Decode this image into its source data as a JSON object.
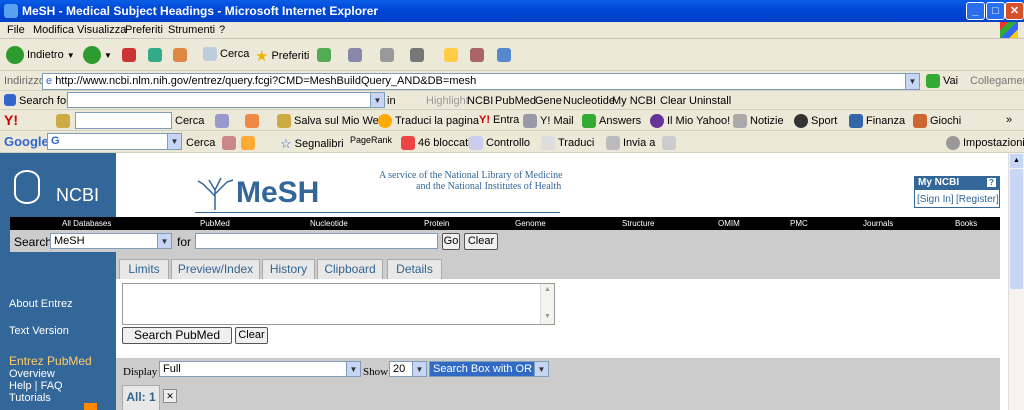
{
  "window": {
    "title": "MeSH - Medical Subject Headings - Microsoft Internet Explorer"
  },
  "menu": [
    "File",
    "Modifica",
    "Visualizza",
    "Preferiti",
    "Strumenti",
    "?"
  ],
  "toolbar": {
    "back": "Indietro",
    "search": "Cerca",
    "favorites": "Preferiti"
  },
  "address": {
    "label": "Indirizzo",
    "url": "http://www.ncbi.nlm.nih.gov/entrez/query.fcgi?CMD=MeshBuildQuery_AND&DB=mesh",
    "go": "Vai",
    "links": "Collegamenti"
  },
  "ncbi_bar": {
    "search_for": "Search for",
    "in": "in",
    "items": [
      "Highlight",
      "NCBI",
      "PubMed",
      "Gene",
      "Nucleotide",
      "My NCBI",
      "Clear",
      "Uninstall"
    ]
  },
  "yahoo_bar": {
    "cerca": "Cerca",
    "items": [
      "Salva sul Mio Web",
      "Traduci la pagina",
      "Entra",
      "Y! Mail",
      "Answers",
      "Il Mio Yahoo!",
      "Notizie",
      "Sport",
      "Finanza",
      "Giochi"
    ]
  },
  "google_bar": {
    "cerca": "Cerca",
    "items": [
      "Segnalibri",
      "PageRank",
      "46 bloccati",
      "Controllo",
      "Traduci",
      "Invia a"
    ],
    "settings": "Impostazioni"
  },
  "page": {
    "ncbi_logo": "NCBI",
    "mesh_logo": "MeSH",
    "service_line1": "A service of the National Library of Medicine",
    "service_line2": "and the National Institutes of Health",
    "myncbi": {
      "title": "My NCBI",
      "signin": "[Sign In]",
      "register": "[Register]"
    },
    "dbnav": [
      "All Databases",
      "PubMed",
      "Nucleotide",
      "Protein",
      "Genome",
      "Structure",
      "OMIM",
      "PMC",
      "Journals",
      "Books"
    ],
    "search_label": "Search",
    "db_selected": "MeSH",
    "for": "for",
    "go": "Go",
    "clear": "Clear",
    "tabs": [
      "Limits",
      "Preview/Index",
      "History",
      "Clipboard",
      "Details"
    ],
    "search_pubmed": "Search PubMed",
    "clear2": "Clear",
    "leftnav": [
      "About Entrez",
      "Text Version",
      "Entrez PubMed",
      "Overview",
      "Help | FAQ",
      "Tutorials"
    ],
    "display_label": "Display",
    "display_value": "Full",
    "show_label": "Show",
    "show_value": "20",
    "searchbox_value": "Search Box with OR",
    "results_tab": "All: 1"
  }
}
